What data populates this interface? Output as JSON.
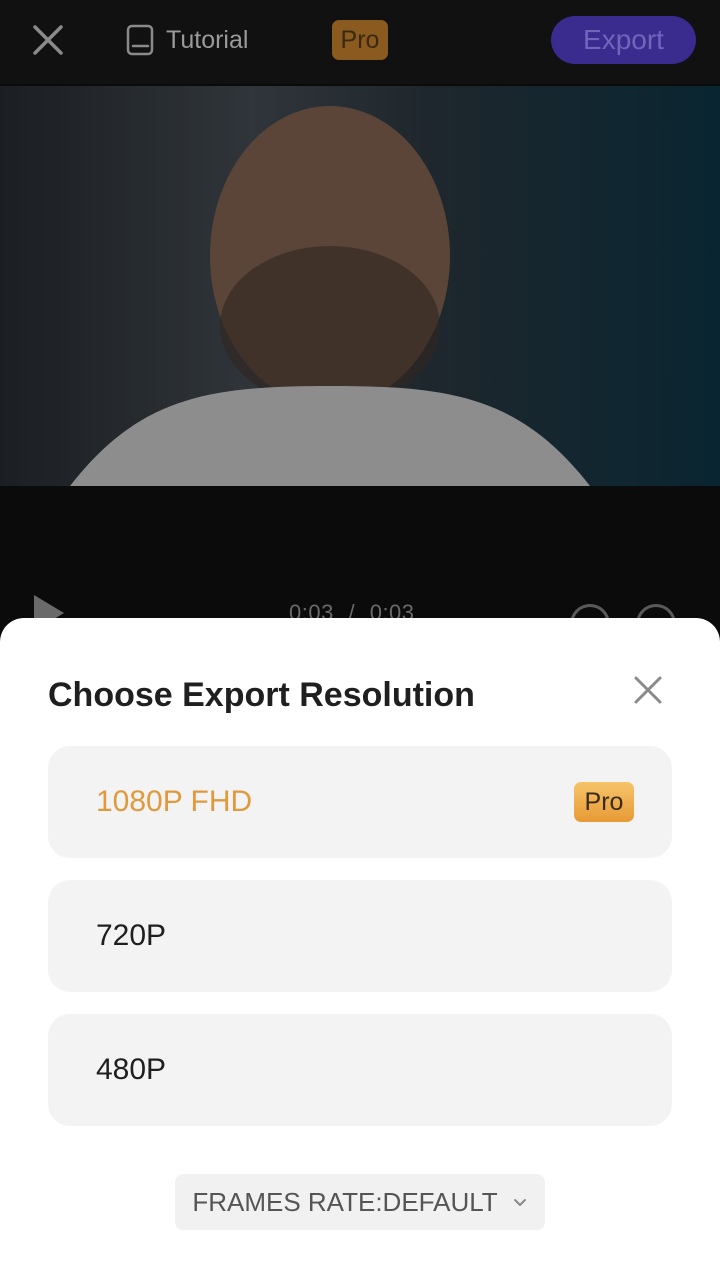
{
  "topbar": {
    "tutorial_label": "Tutorial",
    "pro_label": "Pro",
    "export_label": "Export"
  },
  "player": {
    "current_time": "0:03",
    "separator": "/",
    "total_time": "0:03"
  },
  "sheet": {
    "title": "Choose Export Resolution",
    "options": [
      {
        "label": "1080P FHD",
        "badge": "Pro"
      },
      {
        "label": "720P"
      },
      {
        "label": "480P"
      }
    ],
    "frames_rate_label": "FRAMES RATE:DEFAULT"
  },
  "colors": {
    "accent_pro": "#e09a3e",
    "export_button": "#3a2b8f"
  },
  "icons": [
    "close-icon",
    "book-icon",
    "play-icon",
    "undo-icon",
    "redo-icon",
    "chevron-down-icon"
  ]
}
